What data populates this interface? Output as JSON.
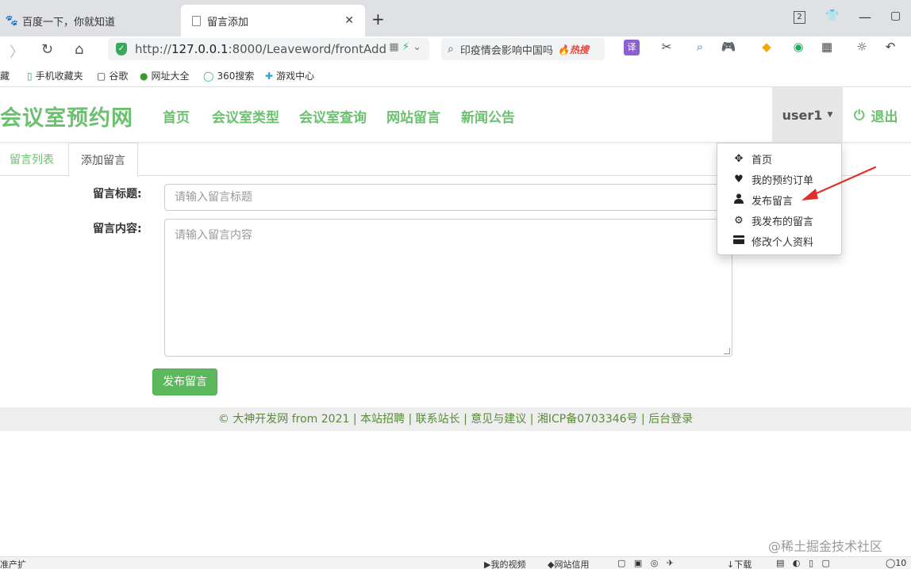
{
  "browser": {
    "tabs": [
      {
        "title": "百度一下，你就知道",
        "icon": "baidu-paw-icon"
      },
      {
        "title": "留言添加",
        "icon": "document-icon",
        "active": true
      }
    ],
    "tab_count": "2",
    "url_prefix": "http://",
    "url_host": "127.0.0.1",
    "url_rest": ":8000/Leaveword/frontAdd",
    "search_text": "印疫情会影响中国吗",
    "search_badge": "热搜",
    "bookmarks": [
      "藏",
      "手机收藏夹",
      "谷歌",
      "网址大全",
      "360搜索",
      "游戏中心"
    ]
  },
  "site": {
    "brand": "会议室预约网",
    "nav": [
      "首页",
      "会议室类型",
      "会议室查询",
      "网站留言",
      "新闻公告"
    ],
    "user": "user1",
    "logout": "退出",
    "accent_color": "#6cc070"
  },
  "content": {
    "tabs": [
      "留言列表",
      "添加留言"
    ],
    "active_tab": "添加留言",
    "title_label": "留言标题:",
    "title_placeholder": "请输入留言标题",
    "body_label": "留言内容:",
    "body_placeholder": "请输入留言内容",
    "submit_label": "发布留言"
  },
  "dropdown": [
    {
      "label": "首页",
      "icon": "move-icon"
    },
    {
      "label": "我的预约订单",
      "icon": "heart-icon"
    },
    {
      "label": "发布留言",
      "icon": "user-icon"
    },
    {
      "label": "我发布的留言",
      "icon": "gear-icon"
    },
    {
      "label": "修改个人资料",
      "icon": "card-icon"
    }
  ],
  "footer": "© 大神开发网 from 2021 | 本站招聘 | 联系站长 | 意见与建议 | 湘ICP备0703346号 | 后台登录",
  "statusbar": {
    "left": "准产扩",
    "video": "我的视频",
    "credit": "网站信用",
    "download": "下载",
    "zoom": "10"
  },
  "watermark": "@稀土掘金技术社区"
}
